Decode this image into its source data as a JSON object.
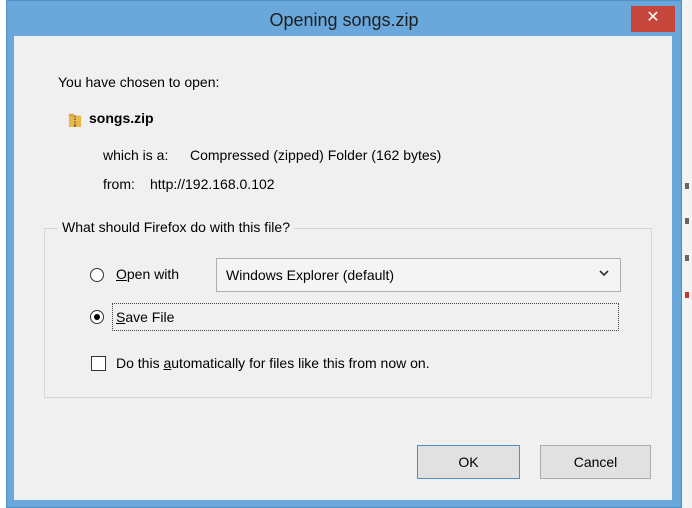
{
  "window": {
    "title": "Opening songs.zip",
    "close_glyph": "✕"
  },
  "content": {
    "intro": "You have chosen to open:",
    "file_name": "songs.zip",
    "which_is_label": "which is a:",
    "file_type": "Compressed (zipped) Folder (162 bytes)",
    "from_label": "from:",
    "from_url": "http://192.168.0.102"
  },
  "action_group": {
    "legend": "What should Firefox do with this file?",
    "open_with": {
      "mnemonic": "O",
      "rest": "pen with",
      "selected": false
    },
    "app_select": {
      "value": "Windows Explorer (default)"
    },
    "save_file": {
      "mnemonic": "S",
      "rest": "ave File",
      "selected": true
    },
    "auto_checkbox": {
      "before": "Do this ",
      "mnemonic": "a",
      "after": "utomatically for files like this from now on.",
      "checked": false
    }
  },
  "buttons": {
    "ok": "OK",
    "cancel": "Cancel"
  },
  "icons": {
    "file": "zip-folder-icon",
    "dropdown": "chevron-down-icon"
  },
  "colors": {
    "titlebar": "#6aa8dc",
    "close": "#c7463c",
    "client": "#f0f0f0"
  }
}
